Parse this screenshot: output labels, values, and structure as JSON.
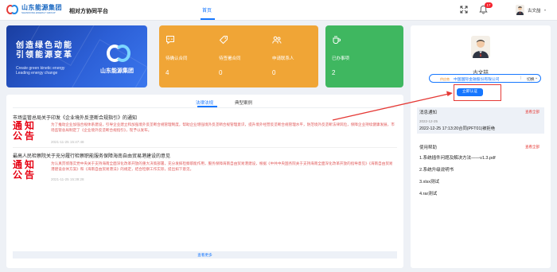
{
  "header": {
    "logo_cn": "山东能源集团",
    "logo_en": "SHANDONG ENERGY GROUP",
    "platform_title": "相对方协同平台",
    "nav_home": "首页",
    "notification_count": "17",
    "user_name": "古文喆"
  },
  "banner": {
    "line1": "创造绿色动能",
    "line2": "引领能源变革",
    "en1": "Create green kinetic energy",
    "en2": "Leading energy change",
    "logo_text": "山东能源集团"
  },
  "stats": [
    {
      "label": "待确认合同",
      "value": "4"
    },
    {
      "label": "待签署合同",
      "value": "0"
    },
    {
      "label": "申请联系人",
      "value": "0"
    },
    {
      "label": "已办事项",
      "value": "2"
    }
  ],
  "colors": {
    "orange": "#f0a536",
    "green": "#3fb760",
    "accent": "#1677ff",
    "badge_red": "#e60012"
  },
  "tabs": [
    "法律法规",
    "典型案例"
  ],
  "news": [
    {
      "title": "市场监管总局关于印发《企业境外反垄断合规指引》的通知",
      "badge": "通知公告",
      "body": "为了推动企业加强合规体系建设，引导企业建立和加强境外反垄断合规管理制度，帮助企业增强境外反垄断合规管理意识，提升境外经营反垄断合规管理水平，防范境外反垄断法律风险，保障企业持续健康发展，市场监管总局制定了《企业境外反垄断合规指引》，现予以发布。",
      "time": "2021-11-25 15:47:48"
    },
    {
      "title": "最高人民检察院关于充分履行检察职能服务保障海南自由贸易港建设的意见",
      "badge": "通知公告",
      "body": "为认真贯彻落实党中央关于支持海南全面深化改革开放的重大决策部署，充分发挥检察职能作用，服务保障海南自由贸易港建设，根据《中共中央国务院关于支持海南全面深化改革开放的指导意见》《海南自由贸易港建设总体方案》和《海南自由贸易港法》的规定，结合检察工作实际，提出如下意见。",
      "time": "2021-11-25 15:39:28"
    }
  ],
  "more_label": "查看更多",
  "profile": {
    "name": "古文喆",
    "role_tag": "供应商",
    "company": "中国国际金融股份有限公司",
    "separator": "|",
    "switch_label": "切换",
    "verify_button": "立即认证"
  },
  "messages": {
    "heading": "消息通知",
    "more": "查看全部",
    "date": "2022-12-25",
    "text": "2022-12-25 17:13:20合同(PFT01)被拒绝"
  },
  "help": {
    "heading": "使用帮助",
    "more": "查看全部",
    "items": [
      "1.系统插件问题及解决方法——v1.3.pdf",
      "2.系统升级说明书",
      "3.xlsx测试",
      "4.rar测试"
    ]
  }
}
